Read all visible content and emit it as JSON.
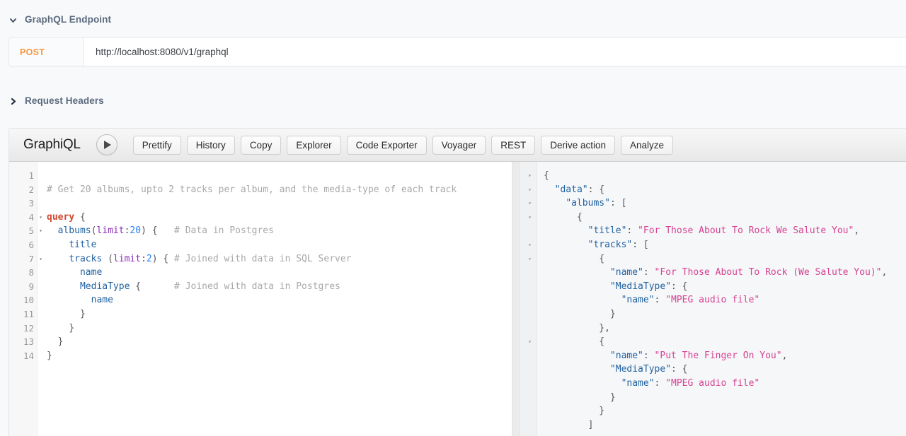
{
  "sections": {
    "endpoint": {
      "title": "GraphQL Endpoint",
      "expanded": true,
      "chevron_icon": "chevron-down-icon",
      "method": "POST",
      "url": "http://localhost:8080/v1/graphql"
    },
    "request_headers": {
      "title": "Request Headers",
      "expanded": false,
      "chevron_icon": "chevron-right-icon"
    }
  },
  "graphiql": {
    "brand": "GraphiQL",
    "execute_icon": "play-icon",
    "toolbar_buttons": [
      "Prettify",
      "History",
      "Copy",
      "Explorer",
      "Code Exporter",
      "Voyager",
      "REST",
      "Derive action",
      "Analyze"
    ],
    "query_editor": {
      "line_numbers": [
        "1",
        "2",
        "3",
        "4",
        "5",
        "6",
        "7",
        "8",
        "9",
        "10",
        "11",
        "12",
        "13",
        "14"
      ],
      "fold_markers": [
        "",
        "",
        "",
        "▾",
        "▾",
        "",
        "▾",
        "",
        "",
        "",
        "",
        "",
        "",
        ""
      ],
      "lines": [
        "",
        "# Get 20 albums, upto 2 tracks per album, and the media-type of each track",
        "",
        "query {",
        "  albums(limit:20) {   # Data in Postgres",
        "    title",
        "    tracks (limit:2) { # Joined with data in SQL Server",
        "      name",
        "      MediaType {      # Joined with data in Postgres",
        "        name",
        "      }",
        "    }",
        "  }",
        "}"
      ]
    },
    "result_viewer": {
      "fold_markers": [
        "▾",
        "▾",
        "▾",
        "▾",
        "",
        "▾",
        "▾",
        "",
        "",
        "",
        "",
        "",
        "▾",
        "",
        "",
        "",
        "",
        ""
      ],
      "lines": [
        "{",
        "  \"data\": {",
        "    \"albums\": [",
        "      {",
        "        \"title\": \"For Those About To Rock We Salute You\",",
        "        \"tracks\": [",
        "          {",
        "            \"name\": \"For Those About To Rock (We Salute You)\",",
        "            \"MediaType\": {",
        "              \"name\": \"MPEG audio file\"",
        "            }",
        "          },",
        "          {",
        "            \"name\": \"Put The Finger On You\",",
        "            \"MediaType\": {",
        "              \"name\": \"MPEG audio file\"",
        "            }",
        "          }",
        "        ]"
      ]
    }
  },
  "colors": {
    "method_accent": "#f8983f",
    "section_title": "#5b6a7d",
    "string": "#d64292",
    "key": "#1f61a0",
    "keyword": "#cf4a30",
    "argument": "#8b2bb9",
    "number": "#2882f9",
    "comment": "#a8a8a8",
    "page_bg": "#f8f9fb"
  }
}
